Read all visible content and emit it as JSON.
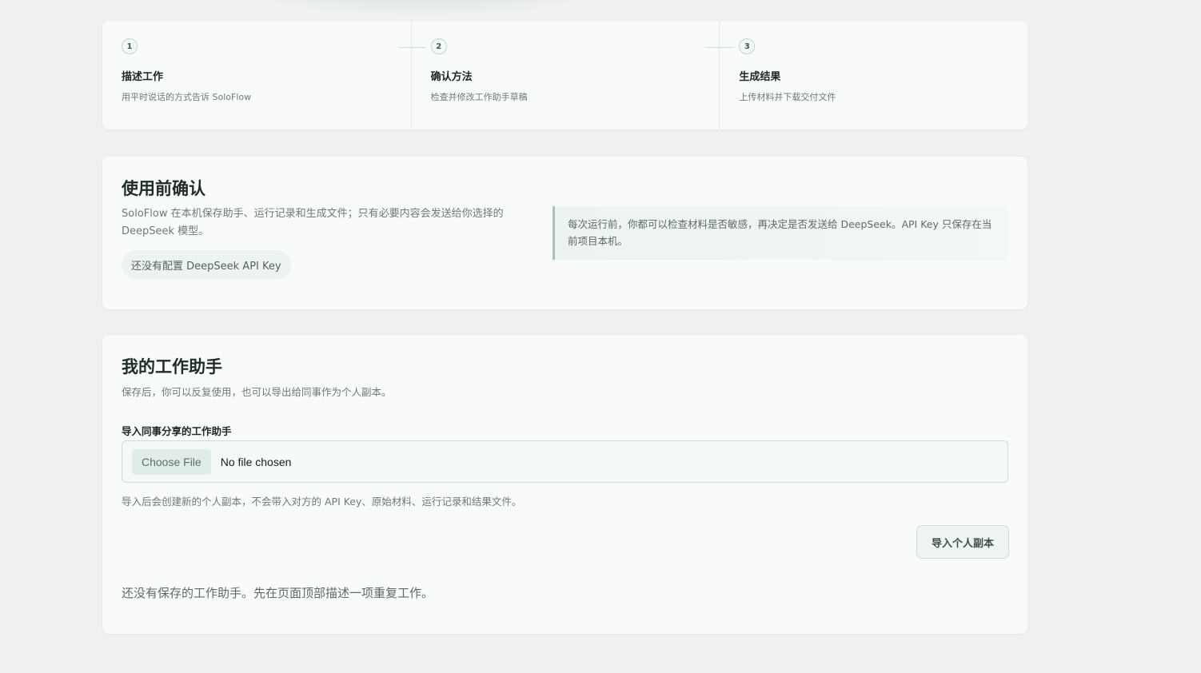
{
  "steps": [
    {
      "number": "1",
      "title": "描述工作",
      "desc": "用平时说话的方式告诉 SoloFlow"
    },
    {
      "number": "2",
      "title": "确认方法",
      "desc": "检查并修改工作助手草稿"
    },
    {
      "number": "3",
      "title": "生成结果",
      "desc": "上传材料并下载交付文件"
    }
  ],
  "confirm": {
    "title": "使用前确认",
    "desc": "SoloFlow 在本机保存助手、运行记录和生成文件；只有必要内容会发送给你选择的 DeepSeek 模型。",
    "api_status": "还没有配置 DeepSeek API Key",
    "notice": "每次运行前，你都可以检查材料是否敏感，再决定是否发送给 DeepSeek。API Key 只保存在当前项目本机。"
  },
  "helpers": {
    "title": "我的工作助手",
    "desc": "保存后，你可以反复使用，也可以导出给同事作为个人副本。",
    "import_label": "导入同事分享的工作助手",
    "choose_file": "Choose File",
    "file_status": "No file chosen",
    "import_note": "导入后会创建新的个人副本，不会带入对方的 API Key、原始材料、运行记录和结果文件。",
    "import_button": "导入个人副本",
    "empty_note": "还没有保存的工作助手。先在页面顶部描述一项重复工作。"
  }
}
